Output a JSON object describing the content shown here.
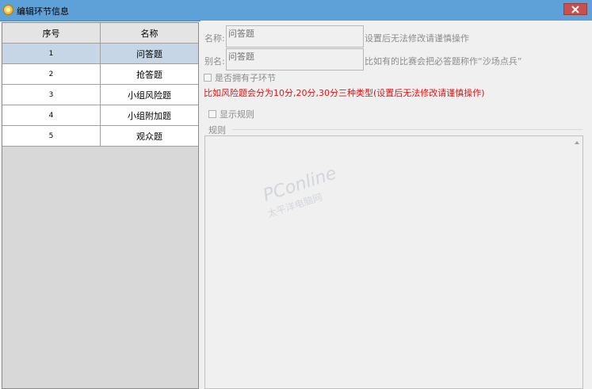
{
  "window": {
    "title": "编辑环节信息"
  },
  "table": {
    "columns": [
      "序号",
      "名称"
    ],
    "rows": [
      {
        "num": "1",
        "name": "问答题",
        "selected": true
      },
      {
        "num": "2",
        "name": "抢答题",
        "selected": false
      },
      {
        "num": "3",
        "name": "小组风险题",
        "selected": false
      },
      {
        "num": "4",
        "name": "小组附加题",
        "selected": false
      },
      {
        "num": "5",
        "name": "观众题",
        "selected": false
      }
    ]
  },
  "form": {
    "name_label": "名称:",
    "name_value": "问答题",
    "name_hint": "设置后无法修改请谨慎操作",
    "alias_label": "别名:",
    "alias_value": "问答题",
    "alias_hint": "比如有的比赛会把必答题称作“沙场点兵”",
    "sub_check_label": "是否拥有子环节",
    "warning": "比如风险题会分为10分,20分,30分三种类型(设置后无法修改请谨慎操作)",
    "show_rules_label": "显示规则",
    "rules_group_label": "规则"
  },
  "watermark": {
    "brand": "PConline",
    "sub": "太平洋电脑网"
  },
  "colors": {
    "titlebar": "#5ea0d8",
    "close": "#c75050",
    "warning": "#e81010",
    "selected_row": "#c6d6e6"
  }
}
